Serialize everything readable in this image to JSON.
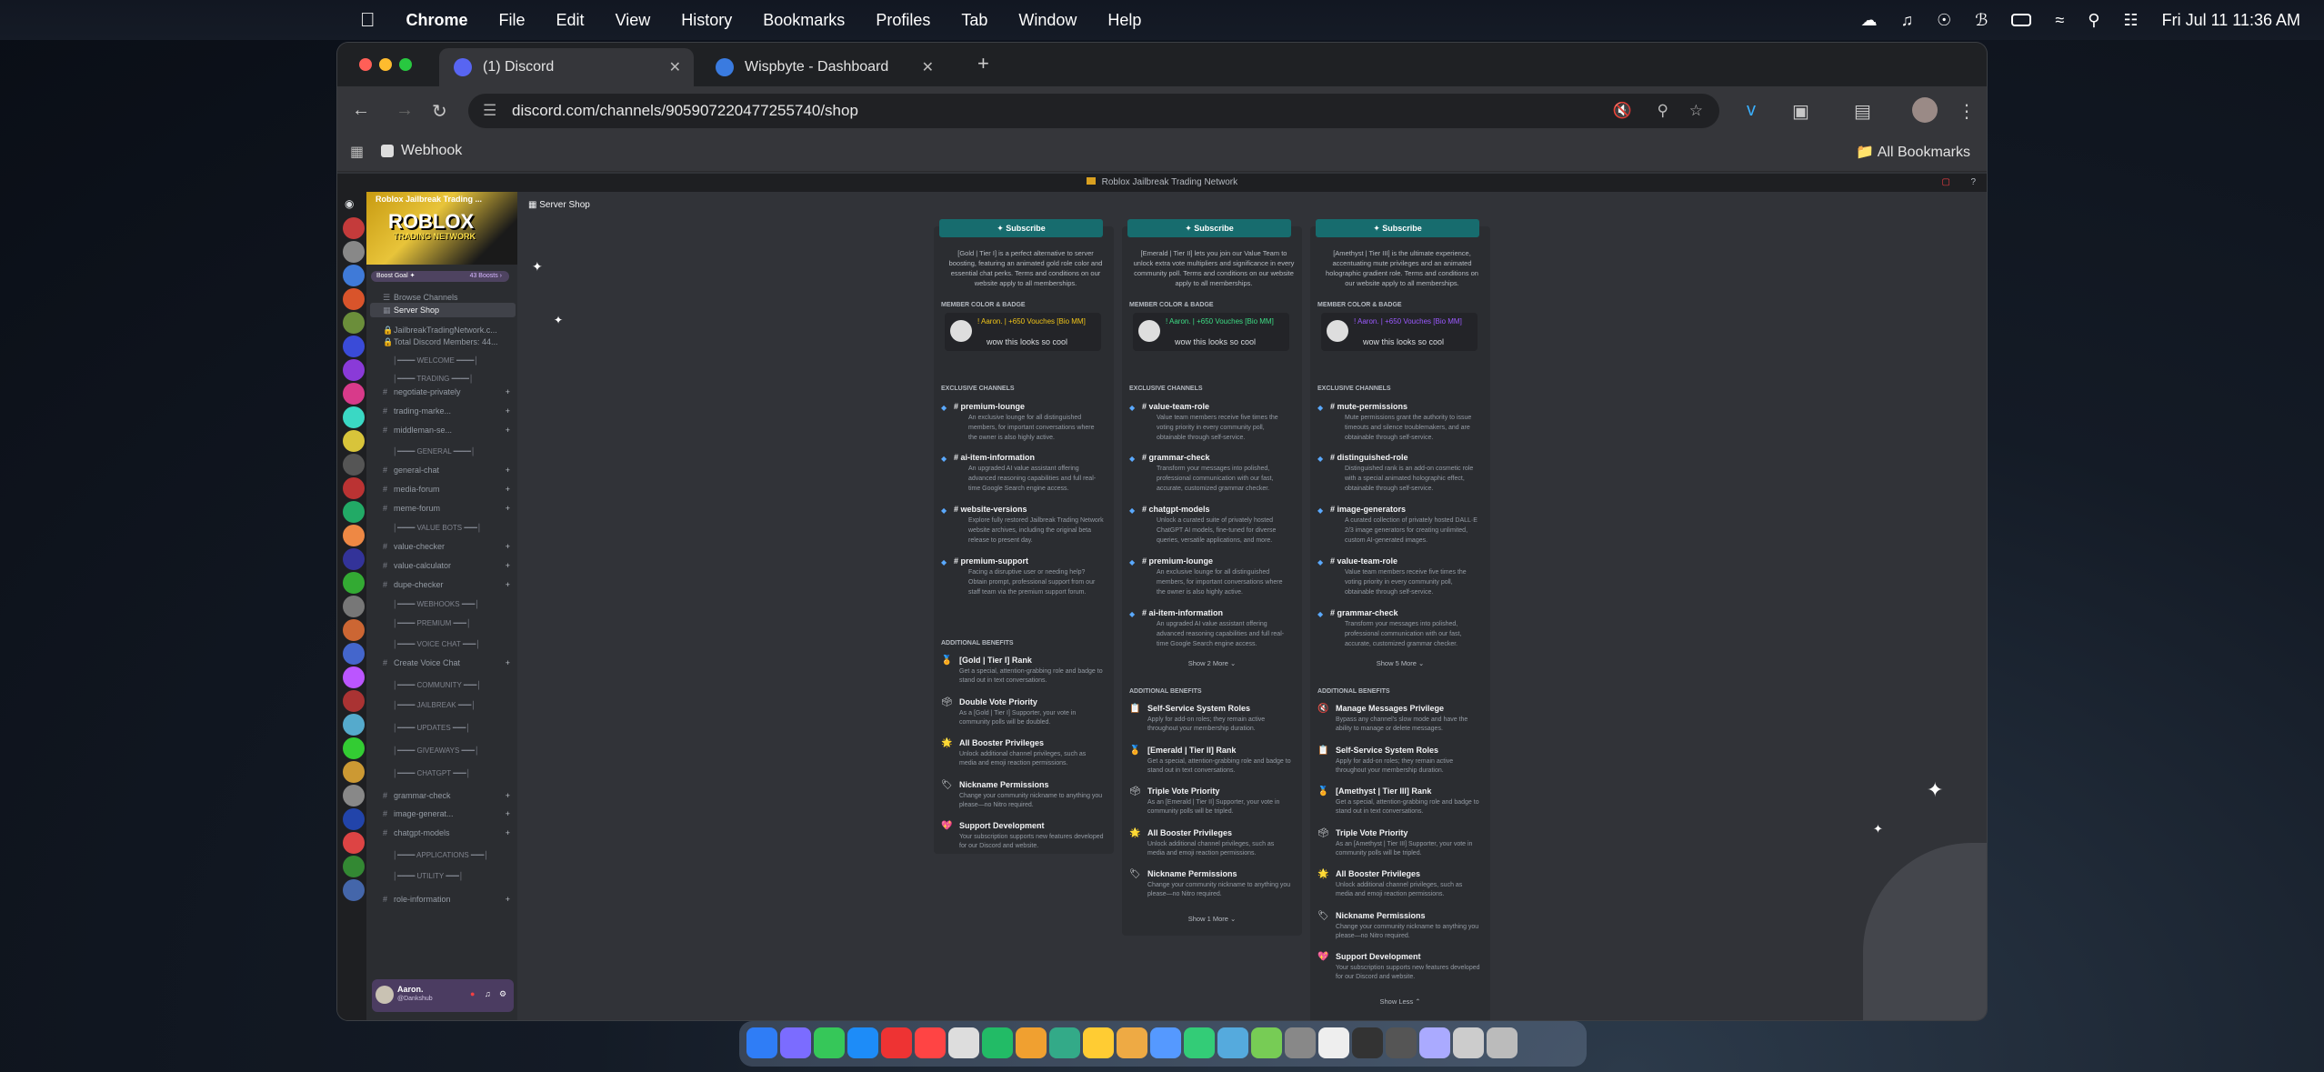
{
  "menubar": {
    "app": "Chrome",
    "items": [
      "File",
      "Edit",
      "View",
      "History",
      "Bookmarks",
      "Profiles",
      "Tab",
      "Window",
      "Help"
    ],
    "clock": "Fri Jul 11  11:36 AM"
  },
  "tabs": [
    {
      "title": "(1) Discord"
    },
    {
      "title": "Wispbyte - Dashboard"
    }
  ],
  "address": {
    "url": "discord.com/channels/905907220477255740/shop"
  },
  "bookmarks": {
    "webhook": "Webhook",
    "all": "All Bookmarks"
  },
  "discord": {
    "window_title": "Roblox Jailbreak Trading Network",
    "server": {
      "name": "Roblox Jailbreak Trading ...",
      "banner_logo": "ROBLOX",
      "banner_sub": "TRADING NETWORK",
      "boost_goal": "Boost Goal ✦",
      "boost_count": "43 Boosts ›"
    },
    "nav": {
      "browse": "Browse Channels",
      "shop": "Server Shop"
    },
    "channels": [
      {
        "name": "JailbreakTradingNetwork.c...",
        "type": "item"
      },
      {
        "name": "Total Discord Members: 44...",
        "type": "item"
      },
      {
        "name": "│━━━━ WELCOME ━━━━│",
        "type": "hd"
      },
      {
        "name": "│━━━━ TRADING ━━━━│",
        "type": "hd"
      },
      {
        "name": "negotiate-privately",
        "type": "ch"
      },
      {
        "name": "trading-marke...",
        "type": "ch"
      },
      {
        "name": "middleman-se...",
        "type": "ch"
      },
      {
        "name": "│━━━━ GENERAL ━━━━│",
        "type": "hd"
      },
      {
        "name": "general-chat",
        "type": "ch"
      },
      {
        "name": "media-forum",
        "type": "ch"
      },
      {
        "name": "meme-forum",
        "type": "ch"
      },
      {
        "name": "│━━━━ VALUE BOTS ━━━│",
        "type": "hd"
      },
      {
        "name": "value-checker",
        "type": "ch"
      },
      {
        "name": "value-calculator",
        "type": "ch"
      },
      {
        "name": "dupe-checker",
        "type": "ch"
      },
      {
        "name": "│━━━━ WEBHOOKS ━━━│",
        "type": "hd"
      },
      {
        "name": "│━━━━ PREMIUM ━━━│",
        "type": "hd"
      },
      {
        "name": "│━━━━ VOICE CHAT ━━━│",
        "type": "hd"
      },
      {
        "name": "Create Voice Chat",
        "type": "ch"
      },
      {
        "name": "│━━━━ COMMUNITY ━━━│",
        "type": "hd"
      },
      {
        "name": "│━━━━ JAILBREAK ━━━│",
        "type": "hd"
      },
      {
        "name": "│━━━━ UPDATES ━━━│",
        "type": "hd"
      },
      {
        "name": "│━━━━ GIVEAWAYS ━━━│",
        "type": "hd"
      },
      {
        "name": "│━━━━ CHATGPT ━━━│",
        "type": "hd"
      },
      {
        "name": "grammar-check",
        "type": "ch"
      },
      {
        "name": "image-generat...",
        "type": "ch"
      },
      {
        "name": "chatgpt-models",
        "type": "ch"
      },
      {
        "name": "│━━━━ APPLICATIONS ━━━│",
        "type": "hd"
      },
      {
        "name": "│━━━━ UTILITY ━━━│",
        "type": "hd"
      },
      {
        "name": "role-information",
        "type": "ch"
      }
    ],
    "user": {
      "name": "Aaron.",
      "tag": "@Dankshub"
    },
    "page_title": "Server Shop",
    "tiers": [
      {
        "subscribe": "✦ Subscribe",
        "desc": "[Gold | Tier I] is a perfect alternative to server boosting, featuring an animated gold role color and essential chat perks. Terms and conditions on our website apply to all memberships.",
        "color_section": "MEMBER COLOR & BADGE",
        "badge_name": "! Aaron. | +650 Vouches [Bio MM]",
        "badge_color": "#f0c419",
        "sample": "wow this looks so cool",
        "channels_section": "EXCLUSIVE CHANNELS",
        "channels": [
          {
            "name": "premium-lounge",
            "desc": "An exclusive lounge for all distinguished members, for important conversations where the owner is also highly active."
          },
          {
            "name": "ai-item-information",
            "desc": "An upgraded AI value assistant offering advanced reasoning capabilities and full real-time Google Search engine access."
          },
          {
            "name": "website-versions",
            "desc": "Explore fully restored Jailbreak Trading Network website archives, including the original beta release to present day."
          },
          {
            "name": "premium-support",
            "desc": "Facing a disruptive user or needing help? Obtain prompt, professional support from our staff team via the premium support forum."
          }
        ],
        "benefits_section": "ADDITIONAL BENEFITS",
        "benefits": [
          {
            "icon": "🏅",
            "name": "[Gold | Tier I] Rank",
            "desc": "Get a special, attention-grabbing role and badge to stand out in text conversations."
          },
          {
            "icon": "🗳",
            "name": "Double Vote Priority",
            "desc": "As a [Gold | Tier I] Supporter, your vote in community polls will be doubled."
          },
          {
            "icon": "🌟",
            "name": "All Booster Privileges",
            "desc": "Unlock additional channel privileges, such as media and emoji reaction permissions."
          },
          {
            "icon": "🏷",
            "name": "Nickname Permissions",
            "desc": "Change your community nickname to anything you please—no Nitro required."
          },
          {
            "icon": "💖",
            "name": "Support Development",
            "desc": "Your subscription supports new features developed for our Discord and website."
          }
        ],
        "more": ""
      },
      {
        "subscribe": "✦ Subscribe",
        "desc": "[Emerald | Tier II] lets you join our Value Team to unlock extra vote multipliers and significance in every community poll. Terms and conditions on our website apply to all memberships.",
        "color_section": "MEMBER COLOR & BADGE",
        "badge_name": "! Aaron. | +650 Vouches [Bio MM]",
        "badge_color": "#3ddc84",
        "sample": "wow this looks so cool",
        "channels_section": "EXCLUSIVE CHANNELS",
        "channels": [
          {
            "name": "value-team-role",
            "desc": "Value team members receive five times the voting priority in every community poll, obtainable through self-service."
          },
          {
            "name": "grammar-check",
            "desc": "Transform your messages into polished, professional communication with our fast, accurate, customized grammar checker."
          },
          {
            "name": "chatgpt-models",
            "desc": "Unlock a curated suite of privately hosted ChatGPT AI models, fine-tuned for diverse queries, versatile applications, and more."
          },
          {
            "name": "premium-lounge",
            "desc": "An exclusive lounge for all distinguished members, for important conversations where the owner is also highly active."
          },
          {
            "name": "ai-item-information",
            "desc": "An upgraded AI value assistant offering advanced reasoning capabilities and full real-time Google Search engine access."
          }
        ],
        "channels_more": "Show 2 More ⌄",
        "benefits_section": "ADDITIONAL BENEFITS",
        "benefits": [
          {
            "icon": "📋",
            "name": "Self-Service System Roles",
            "desc": "Apply for add-on roles; they remain active throughout your membership duration."
          },
          {
            "icon": "🏅",
            "name": "[Emerald | Tier II] Rank",
            "desc": "Get a special, attention-grabbing role and badge to stand out in text conversations."
          },
          {
            "icon": "🗳",
            "name": "Triple Vote Priority",
            "desc": "As an [Emerald | Tier II] Supporter, your vote in community polls will be tripled."
          },
          {
            "icon": "🌟",
            "name": "All Booster Privileges",
            "desc": "Unlock additional channel privileges, such as media and emoji reaction permissions."
          },
          {
            "icon": "🏷",
            "name": "Nickname Permissions",
            "desc": "Change your community nickname to anything you please—no Nitro required."
          }
        ],
        "more": "Show 1 More ⌄"
      },
      {
        "subscribe": "✦ Subscribe",
        "desc": "[Amethyst | Tier III] is the ultimate experience, accentuating mute privileges and an animated holographic gradient role. Terms and conditions on our website apply to all memberships.",
        "color_section": "MEMBER COLOR & BADGE",
        "badge_name": "! Aaron. | +650 Vouches [Bio MM]",
        "badge_color": "#9b59ff",
        "sample": "wow this looks so cool",
        "channels_section": "EXCLUSIVE CHANNELS",
        "channels": [
          {
            "name": "mute-permissions",
            "desc": "Mute permissions grant the authority to issue timeouts and silence troublemakers, and are obtainable through self-service."
          },
          {
            "name": "distinguished-role",
            "desc": "Distinguished rank is an add-on cosmetic role with a special animated holographic effect, obtainable through self-service."
          },
          {
            "name": "image-generators",
            "desc": "A curated collection of privately hosted DALL·E 2/3 image generators for creating unlimited, custom AI-generated images."
          },
          {
            "name": "value-team-role",
            "desc": "Value team members receive five times the voting priority in every community poll, obtainable through self-service."
          },
          {
            "name": "grammar-check",
            "desc": "Transform your messages into polished, professional communication with our fast, accurate, customized grammar checker."
          }
        ],
        "channels_more": "Show 5 More ⌄",
        "benefits_section": "ADDITIONAL BENEFITS",
        "benefits": [
          {
            "icon": "🔇",
            "name": "Manage Messages Privilege",
            "desc": "Bypass any channel's slow mode and have the ability to manage or delete messages."
          },
          {
            "icon": "📋",
            "name": "Self-Service System Roles",
            "desc": "Apply for add-on roles; they remain active throughout your membership duration."
          },
          {
            "icon": "🏅",
            "name": "[Amethyst | Tier III] Rank",
            "desc": "Get a special, attention-grabbing role and badge to stand out in text conversations."
          },
          {
            "icon": "🗳",
            "name": "Triple Vote Priority",
            "desc": "As an [Amethyst | Tier III] Supporter, your vote in community polls will be tripled."
          },
          {
            "icon": "🌟",
            "name": "All Booster Privileges",
            "desc": "Unlock additional channel privileges, such as media and emoji reaction permissions."
          },
          {
            "icon": "🏷",
            "name": "Nickname Permissions",
            "desc": "Change your community nickname to anything you please—no Nitro required."
          },
          {
            "icon": "💖",
            "name": "Support Development",
            "desc": "Your subscription supports new features developed for our Discord and website."
          }
        ],
        "more": "Show Less ⌃"
      }
    ]
  },
  "colors": {
    "accent": "#176c6e",
    "discord_bg": "#313338",
    "sidebar": "#2b2d31",
    "guild_bar": "#1e1f22"
  }
}
